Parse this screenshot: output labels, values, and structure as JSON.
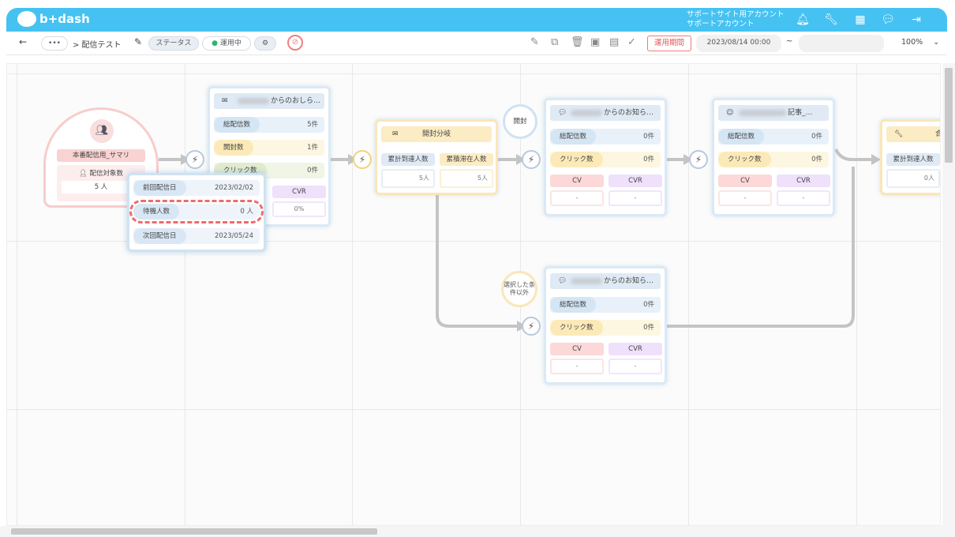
{
  "header": {
    "logo": "b+dash",
    "account_line1": "サポートサイト用アカウント",
    "account_line2": "サポートアカウント"
  },
  "toolbar": {
    "back": "←",
    "more": "•••",
    "breadcrumb": "> 配信テスト",
    "status_label": "ステータス",
    "running_label": "運用中",
    "period_button": "運用期間",
    "start_datetime": "2023/08/14 00:00",
    "tilde": "~",
    "zoom": "100%"
  },
  "segment": {
    "title": "本番配信用_サマリ",
    "target_label": "配信対象数",
    "target_value": "5 人"
  },
  "popup": {
    "prev_label": "前回配信日",
    "prev_value": "2023/02/02",
    "wait_label": "待機人数",
    "wait_value": "0 人",
    "next_label": "次回配信日",
    "next_value": "2023/05/24"
  },
  "mail1": {
    "title": "からのおしら…",
    "sent_label": "総配信数",
    "sent_value": "5件",
    "open_label": "開封数",
    "open_value": "1件",
    "click_label": "クリック数",
    "click_value": "0件",
    "cvr_label": "CVR",
    "cvr_value": "0%"
  },
  "branch": {
    "title": "開封分岐",
    "cum_label": "累計到達人数",
    "cum_value": "5人",
    "stay_label": "累積滞在人数",
    "stay_value": "5人"
  },
  "badge_open": "開封",
  "badge_else": "選択した条件以外",
  "line1": {
    "title": "からのお知ら…",
    "sent_label": "総配信数",
    "sent_value": "0件",
    "click_label": "クリック数",
    "click_value": "0件",
    "cv_label": "CV",
    "cvr_label": "CVR",
    "cv_value": "-",
    "cvr_value": "-"
  },
  "push1": {
    "title": "記事_…",
    "sent_label": "総配信数",
    "sent_value": "0件",
    "click_label": "クリック数",
    "click_value": "0件",
    "cv_label": "CV",
    "cvr_label": "CVR",
    "cv_value": "-",
    "cvr_value": "-"
  },
  "line2": {
    "title": "からのお知ら…",
    "sent_label": "総配信数",
    "sent_value": "0件",
    "click_label": "クリック数",
    "click_value": "0件",
    "cv_label": "CV",
    "cvr_label": "CVR",
    "cv_value": "-",
    "cvr_value": "-"
  },
  "merge": {
    "title": "合流",
    "cum_label": "累計到達人数",
    "cum_value": "0人"
  }
}
